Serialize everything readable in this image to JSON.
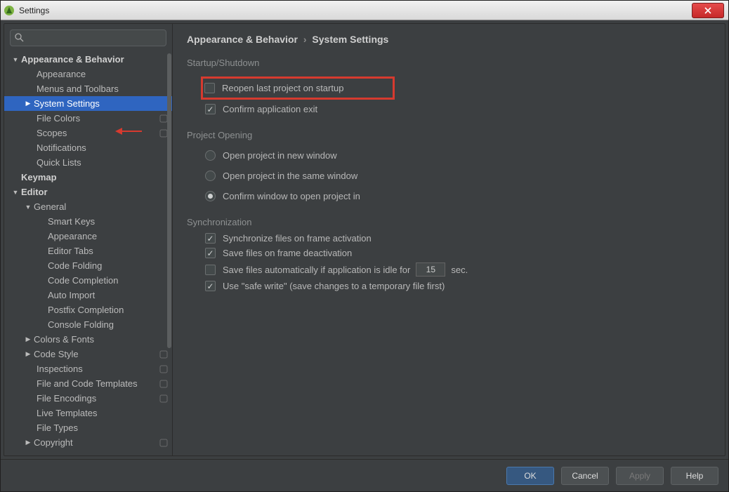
{
  "window": {
    "title": "Settings"
  },
  "search": {
    "placeholder": ""
  },
  "tree": {
    "appearance_behavior": "Appearance & Behavior",
    "appearance": "Appearance",
    "menus_toolbars": "Menus and Toolbars",
    "system_settings": "System Settings",
    "file_colors": "File Colors",
    "scopes": "Scopes",
    "notifications": "Notifications",
    "quick_lists": "Quick Lists",
    "keymap": "Keymap",
    "editor": "Editor",
    "general": "General",
    "smart_keys": "Smart Keys",
    "appearance2": "Appearance",
    "editor_tabs": "Editor Tabs",
    "code_folding": "Code Folding",
    "code_completion": "Code Completion",
    "auto_import": "Auto Import",
    "postfix_completion": "Postfix Completion",
    "console_folding": "Console Folding",
    "colors_fonts": "Colors & Fonts",
    "code_style": "Code Style",
    "inspections": "Inspections",
    "file_code_templates": "File and Code Templates",
    "file_encodings": "File Encodings",
    "live_templates": "Live Templates",
    "file_types": "File Types",
    "copyright": "Copyright"
  },
  "breadcrumb": {
    "root": "Appearance & Behavior",
    "leaf": "System Settings"
  },
  "sections": {
    "startup": "Startup/Shutdown",
    "project_opening": "Project Opening",
    "synchronization": "Synchronization"
  },
  "opts": {
    "reopen": "Reopen last project on startup",
    "confirm_exit": "Confirm application exit",
    "open_new": "Open project in new window",
    "open_same": "Open project in the same window",
    "confirm_window": "Confirm window to open project in",
    "sync_frame": "Synchronize files on frame activation",
    "save_deact": "Save files on frame deactivation",
    "save_auto_prefix": "Save files automatically if application is idle for",
    "save_auto_value": "15",
    "save_auto_suffix": "sec.",
    "safe_write": "Use \"safe write\" (save changes to a temporary file first)"
  },
  "buttons": {
    "ok": "OK",
    "cancel": "Cancel",
    "apply": "Apply",
    "help": "Help"
  }
}
